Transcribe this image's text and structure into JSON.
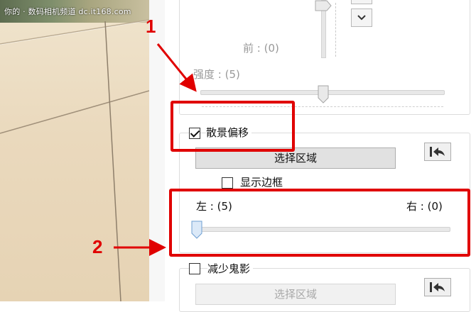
{
  "watermark": "你的 · 数码相机频道 dc.it168.com",
  "panel": {
    "slider_front": {
      "label": "前 : (0)",
      "value": 0
    },
    "strength": {
      "label": "强度 : (5)",
      "value": 5
    },
    "bokeh_shift": {
      "checkbox_label": "散景偏移",
      "checked": true,
      "select_area_button": "选择区域",
      "show_border_label": "显示边框",
      "show_border_checked": false,
      "left_label": "左 : (5)",
      "right_label": "右 : (0)",
      "left_value": 5,
      "right_value": 0
    },
    "reduce_ghosting": {
      "checkbox_label": "减少鬼影",
      "checked": false,
      "select_area_button": "选择区域",
      "button_enabled": false
    }
  },
  "annotations": {
    "marker_1": "1",
    "marker_2": "2",
    "color": "#e00000"
  }
}
